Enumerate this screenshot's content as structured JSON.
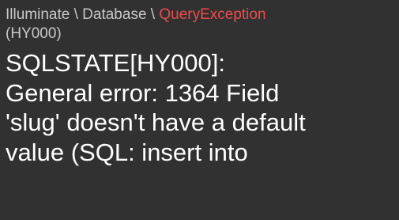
{
  "exception": {
    "namespace": [
      "Illuminate",
      "Database"
    ],
    "separator": " \\ ",
    "name": "QueryException",
    "code": "(HY000)"
  },
  "message": {
    "lines": [
      "SQLSTATE[HY000]:",
      "General error: 1364 Field",
      "'slug' doesn't have a default",
      "value (SQL: insert into"
    ]
  },
  "colors": {
    "background": "#313131",
    "namespace_text": "#c8c8c8",
    "exception_name": "#ee4b4b",
    "message_text": "#ffffff"
  }
}
